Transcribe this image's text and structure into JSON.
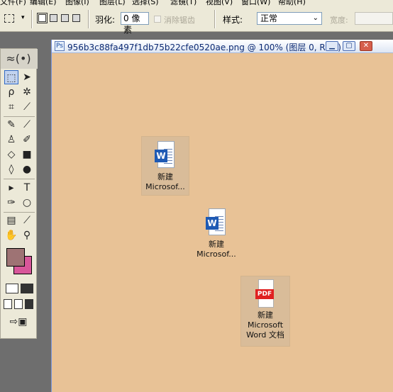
{
  "menu": {
    "items": [
      "文件(F)",
      "编辑(E)",
      "图像(I)",
      "图层(L)",
      "选择(S)",
      "滤镜(T)",
      "视图(V)",
      "窗口(W)",
      "帮助(H)"
    ]
  },
  "options": {
    "feather_label": "羽化:",
    "feather_value": "0 像素",
    "anti_alias_label": "消除锯齿",
    "style_label": "样式:",
    "style_value": "正常",
    "width_label": "宽度:"
  },
  "document": {
    "title": "956b3c88fa497f1db75b22cfe0520ae.png @ 100% (图层 0, RGB)",
    "background_color": "#e8c296"
  },
  "colors": {
    "foreground": "#9e7374",
    "background": "#d8569a"
  },
  "canvas_items": [
    {
      "icon": "word-file-icon",
      "label": "新建\nMicrosof..."
    },
    {
      "icon": "word-file-icon",
      "label": "新建\nMicrosof..."
    },
    {
      "icon": "pdf-file-icon",
      "label": "新建\nMicrosoft\nWord 文档",
      "badge": "PDF"
    }
  ],
  "word_badge": "W"
}
